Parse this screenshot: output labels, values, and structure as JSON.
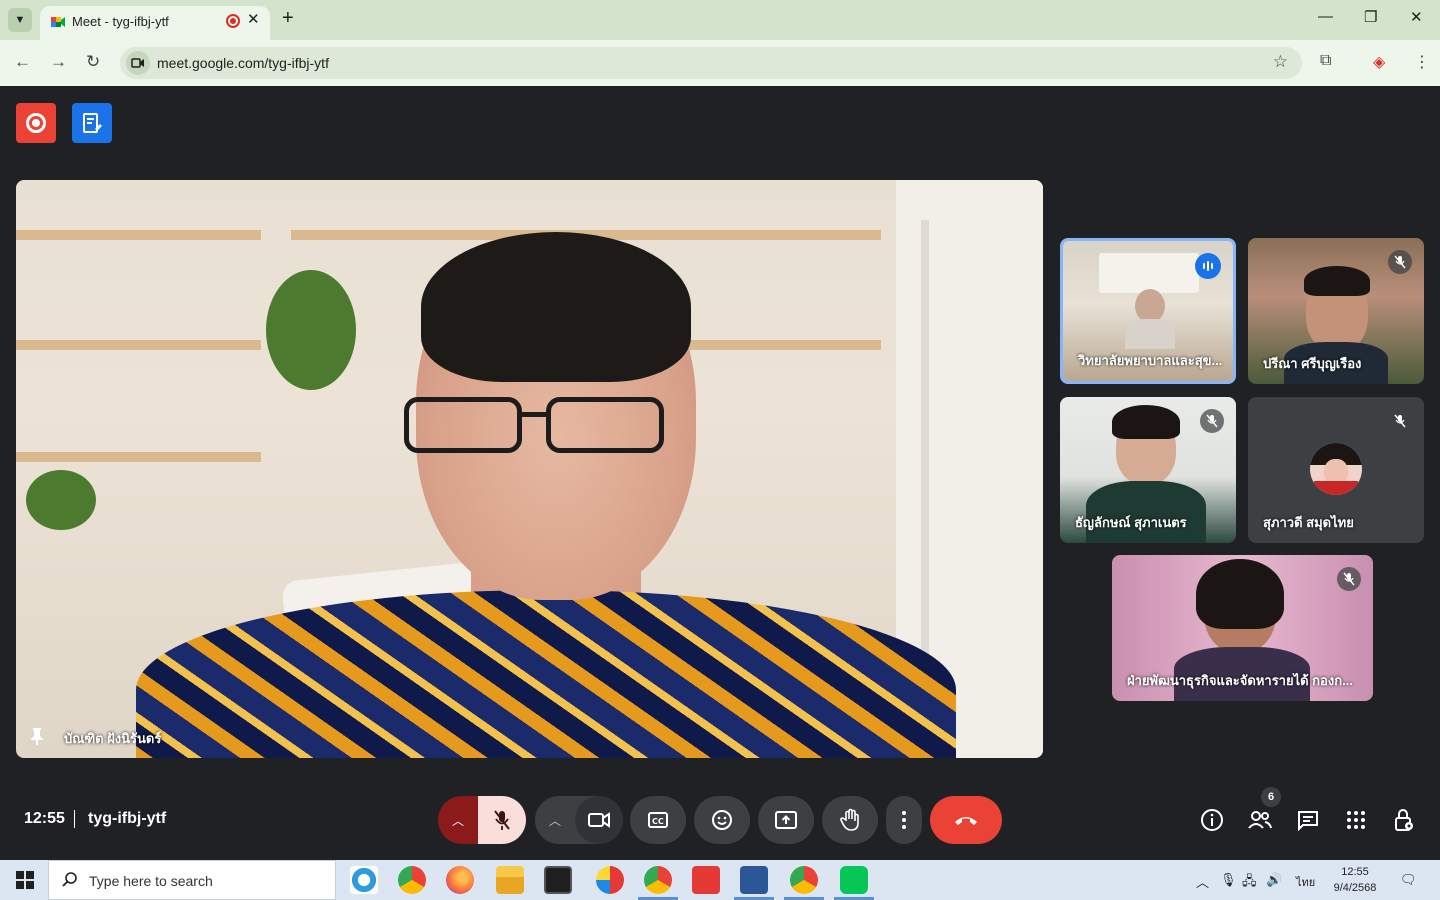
{
  "browser": {
    "tab_title": "Meet - tyg-ifbj-ytf",
    "url": "meet.google.com/tyg-ifbj-ytf",
    "new_tab_label": "+",
    "close_tab_label": "✕",
    "window_controls": {
      "minimize": "—",
      "maximize": "❐",
      "close": "✕"
    }
  },
  "meet": {
    "main_speaker": {
      "name": "บัณฑิต ฝังนิรันดร์",
      "pinned": true
    },
    "participants": [
      {
        "name": "วิทยาลัยพยาบาลและสุข...",
        "speaking": true,
        "muted": false
      },
      {
        "name": "ปรีณา ศรีบุญเรือง",
        "speaking": false,
        "muted": true
      },
      {
        "name": "ธัญลักษณ์ สุภาเนตร",
        "speaking": false,
        "muted": true
      },
      {
        "name": "สุภาวดี สมุดไทย",
        "speaking": false,
        "muted": true
      },
      {
        "name": "ฝ่ายพัฒนาธุรกิจและจัดหารายได้ กองก...",
        "speaking": false,
        "muted": true
      }
    ],
    "bottom_bar": {
      "time": "12:55",
      "meeting_code": "tyg-ifbj-ytf",
      "people_count": "6"
    }
  },
  "taskbar": {
    "search_placeholder": "Type here to search",
    "clock_time": "12:55",
    "clock_date": "9/4/2568",
    "language": "ไทย"
  },
  "colors": {
    "tab_strip": "#d3e3cc",
    "address_bar": "#eef5ea",
    "meet_bg": "#202124",
    "record_red": "#ea4335",
    "notes_blue": "#1a73e8",
    "end_call_red": "#ea4335"
  }
}
